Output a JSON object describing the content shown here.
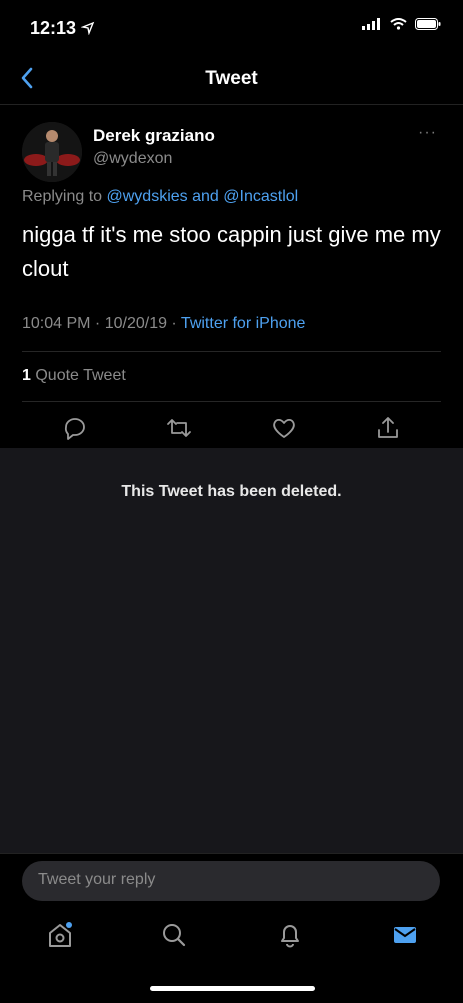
{
  "status": {
    "time": "12:13"
  },
  "header": {
    "title": "Tweet"
  },
  "tweet": {
    "name": "Derek graziano",
    "handle": "@wydexon",
    "more": "···",
    "replying_prefix": "Replying to",
    "replying_user1": "@wydskies",
    "replying_and": "and",
    "replying_user2": "@Incastlol",
    "text": "nigga tf it's me stoo cappin just give me my clout",
    "timestamp": "10:04 PM · 10/20/19 · ",
    "source": "Twitter for iPhone",
    "quote_count": "1",
    "quote_label": "Quote Tweet"
  },
  "deleted": {
    "message": "This Tweet has been deleted."
  },
  "reply": {
    "placeholder": "Tweet your reply"
  },
  "colors": {
    "accent": "#4ea1f0",
    "background": "#000000",
    "panel": "#17171b"
  },
  "icons": [
    "back-chevron-icon",
    "reply-icon",
    "retweet-icon",
    "like-icon",
    "share-icon",
    "home-icon",
    "search-icon",
    "notifications-icon",
    "messages-icon"
  ]
}
